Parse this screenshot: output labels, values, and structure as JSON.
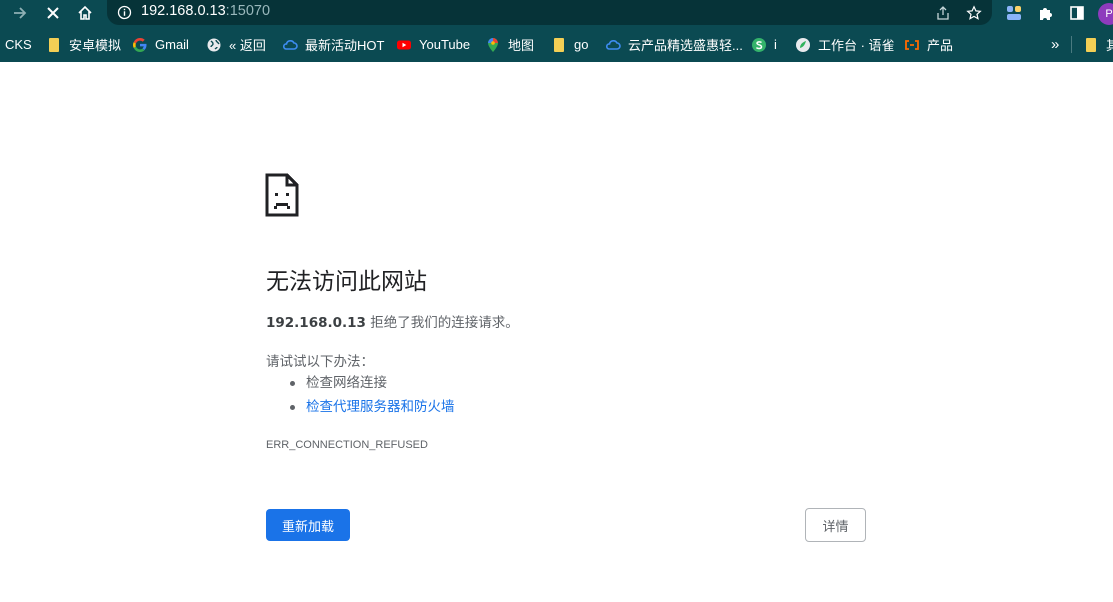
{
  "browser": {
    "address": {
      "host": "192.168.0.13",
      "port": ":15070"
    }
  },
  "bookmarks": [
    {
      "label": "CKS",
      "icon": "none"
    },
    {
      "label": "安卓模拟",
      "icon": "folder-icon"
    },
    {
      "label": "Gmail",
      "icon": "google-icon"
    },
    {
      "label": "« 返回",
      "icon": "globe-icon"
    },
    {
      "label": "最新活动HOT",
      "icon": "cloud-icon"
    },
    {
      "label": "YouTube",
      "icon": "youtube-icon"
    },
    {
      "label": "地图",
      "icon": "maps-pin-icon"
    },
    {
      "label": "go",
      "icon": "folder-icon"
    },
    {
      "label": "云产品精选盛惠轻...",
      "icon": "cloud-icon"
    },
    {
      "label": "i",
      "icon": "s-badge-icon"
    },
    {
      "label": "工作台 · 语雀",
      "icon": "yuque-icon"
    },
    {
      "label": "产品",
      "icon": "bracket-icon"
    },
    {
      "label": "»",
      "icon": "overflow-chevron"
    },
    {
      "label": "其",
      "icon": "folder-icon"
    }
  ],
  "colors": {
    "toolbar": "#0b4a52",
    "omnibox": "#063338",
    "primary_button": "#1a73e8",
    "link": "#1a73e8",
    "text": "#5f6368",
    "folder": "#f3cf55"
  },
  "profile_initial": "P",
  "error": {
    "title": "无法访问此网站",
    "host": "192.168.0.13",
    "message": " 拒绝了我们的连接请求。",
    "try_label": "请试试以下办法：",
    "suggestions": [
      "检查网络连接",
      "检查代理服务器和防火墙"
    ],
    "code": "ERR_CONNECTION_REFUSED",
    "reload_label": "重新加载",
    "details_label": "详情"
  }
}
